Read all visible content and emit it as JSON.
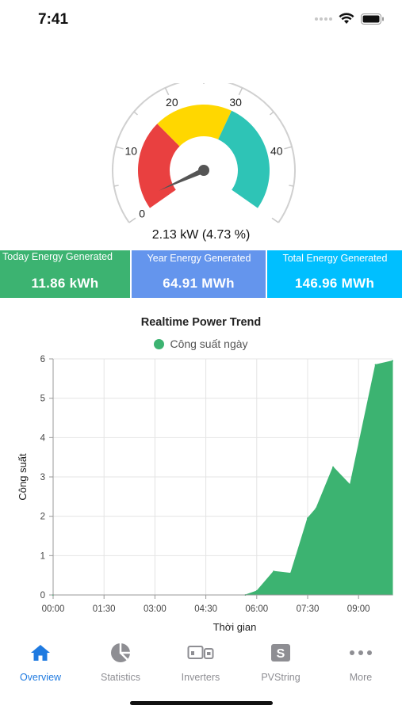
{
  "status_bar": {
    "time": "7:41"
  },
  "gauge": {
    "min": 0,
    "max": 50,
    "value": 2.13,
    "tick_labels": [
      "0",
      "10",
      "20",
      "30",
      "40"
    ],
    "bands": [
      {
        "from": 0,
        "to": 16,
        "color": "#e94040"
      },
      {
        "from": 16,
        "to": 30,
        "color": "#ffd700"
      },
      {
        "from": 30,
        "to": 50,
        "color": "#2ec4b6"
      }
    ],
    "readout": "2.13 kW  (4.73 %)"
  },
  "stats": {
    "today": {
      "label": "Today Energy Generated",
      "value": "11.86 kWh",
      "color": "#3cb371"
    },
    "year": {
      "label": "Year Energy Generated",
      "value": "64.91 MWh",
      "color": "#6495ed"
    },
    "total": {
      "label": "Total Energy Generated",
      "value": "146.96 MWh",
      "color": "#00bfff"
    }
  },
  "chart_data": {
    "type": "area",
    "title": "Realtime Power Trend",
    "xlabel": "Thời gian",
    "ylabel": "Công suất",
    "x_ticks": [
      "00:00",
      "01:30",
      "03:00",
      "04:30",
      "06:00",
      "07:30",
      "09:00"
    ],
    "y_ticks": [
      "0",
      "1",
      "2",
      "3",
      "4",
      "5",
      "6"
    ],
    "ylim": [
      0,
      6
    ],
    "xlim_hours": [
      0,
      10
    ],
    "grid": true,
    "legend_position": "top-center",
    "series": [
      {
        "name": "Công suất ngày",
        "color": "#3cb371",
        "x": [
          "00:00",
          "05:40",
          "06:00",
          "06:30",
          "07:00",
          "07:30",
          "07:45",
          "08:15",
          "08:45",
          "09:30",
          "10:00"
        ],
        "values": [
          0,
          0,
          0.1,
          0.6,
          0.55,
          1.95,
          2.2,
          3.25,
          2.8,
          5.85,
          5.95
        ]
      }
    ]
  },
  "tabs": [
    {
      "label": "Overview",
      "icon": "home-icon",
      "active": true
    },
    {
      "label": "Statistics",
      "icon": "pie-chart-icon",
      "active": false
    },
    {
      "label": "Inverters",
      "icon": "inverter-icon",
      "active": false
    },
    {
      "label": "PVString",
      "icon": "pvstring-icon",
      "active": false
    },
    {
      "label": "More",
      "icon": "more-icon",
      "active": false
    }
  ],
  "colors": {
    "accent": "#1f7ae0",
    "inactive": "#8e8e93"
  }
}
